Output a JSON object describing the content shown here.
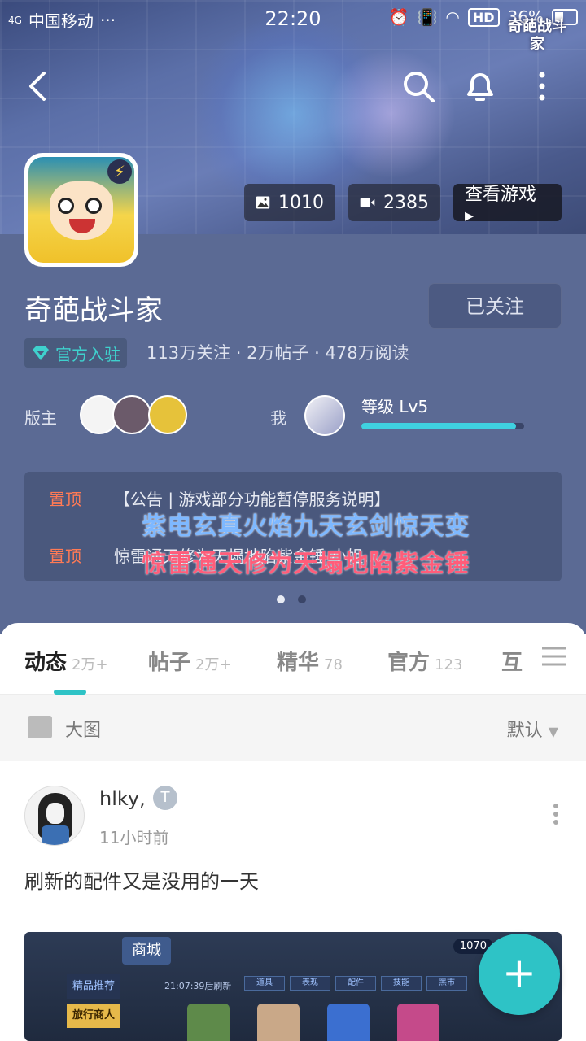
{
  "status": {
    "carrier": "中国移动",
    "signal": "4G",
    "time": "22:20",
    "hd": "HD",
    "battery": "36%"
  },
  "banner": {
    "game_logo": "奇葩战斗家"
  },
  "chips": {
    "images": "1010",
    "videos": "2385",
    "view_game": "查看游戏 ▸"
  },
  "forum": {
    "title": "奇葩战斗家",
    "follow_label": "已关注",
    "official_badge": "官方入驻",
    "stats": "113万关注 · 2万帖子 · 478万阅读",
    "moderator_label": "版主",
    "me_label": "我",
    "level": "等级 Lv5",
    "level_progress": 0.95
  },
  "notices": [
    {
      "pin": "置顶",
      "text": "【公告 | 游戏部分功能暂停服务说明】"
    },
    {
      "pin": "置顶",
      "text": "惊雷通天修为天塌地陷紫金锤 小姐…"
    }
  ],
  "overlay": {
    "line1": "紫电玄真火焰九天玄剑惊天变",
    "line2": "惊雷通天修为天塌地陷紫金锤"
  },
  "tabs": [
    {
      "label": "动态",
      "count": "2万+"
    },
    {
      "label": "帖子",
      "count": "2万+"
    },
    {
      "label": "精华",
      "count": "78"
    },
    {
      "label": "官方",
      "count": "123"
    },
    {
      "label": "互",
      "count": ""
    }
  ],
  "filter": {
    "view": "大图",
    "sort": "默认"
  },
  "post": {
    "username": "hlky,",
    "user_badge": "T",
    "time": "11小时前",
    "text": "刷新的配件又是没用的一天",
    "shot": {
      "mall": "商城",
      "coins": "1070",
      "side1": "精品推荐",
      "side2": "旅行商人",
      "refresh": "21:07:39后刷新",
      "tabs": [
        "道具",
        "表现",
        "配件",
        "技能",
        "黑市"
      ]
    }
  },
  "fab": "+"
}
